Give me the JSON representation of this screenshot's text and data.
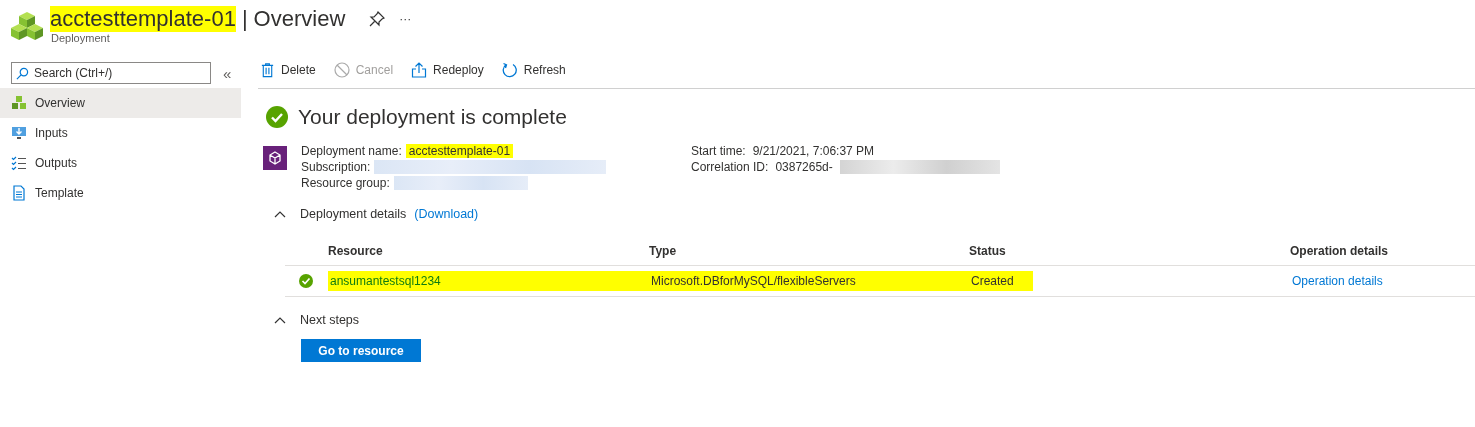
{
  "header": {
    "title": "acctesttemplate-01",
    "title_highlighted": true,
    "separator": "|",
    "page": "Overview",
    "subtitle": "Deployment",
    "more": "···"
  },
  "sidebar": {
    "search": {
      "placeholder": "Search (Ctrl+/)"
    },
    "collapse": "«",
    "items": [
      {
        "label": "Overview",
        "kind": "overview",
        "selected": true
      },
      {
        "label": "Inputs",
        "kind": "inputs",
        "selected": false
      },
      {
        "label": "Outputs",
        "kind": "outputs",
        "selected": false
      },
      {
        "label": "Template",
        "kind": "template",
        "selected": false
      }
    ]
  },
  "toolbar": [
    {
      "label": "Delete",
      "kind": "delete",
      "disabled": false
    },
    {
      "label": "Cancel",
      "kind": "cancel",
      "disabled": true
    },
    {
      "label": "Redeploy",
      "kind": "redeploy",
      "disabled": false
    },
    {
      "label": "Refresh",
      "kind": "refresh",
      "disabled": false
    }
  ],
  "status": {
    "title": "Your deployment is complete"
  },
  "info_left": [
    {
      "label": "Deployment name:",
      "value": "acctesttemplate-01",
      "highlighted": true
    },
    {
      "label": "Subscription:",
      "redacted": true
    },
    {
      "label": "Resource group:",
      "redacted": true
    }
  ],
  "info_right": [
    {
      "label": "Start time:",
      "value": "9/21/2021, 7:06:37 PM"
    },
    {
      "label": "Correlation ID:",
      "value": "0387265d-",
      "redacted": true
    }
  ],
  "details": {
    "title": "Deployment details",
    "link": "(Download)",
    "expanded": true,
    "columns": [
      "Resource",
      "Type",
      "Status",
      "Operation details"
    ],
    "rows": [
      {
        "resource": "ansumantestsql1234",
        "type": "Microsoft.DBforMySQL/flexibleServers",
        "status": "Created",
        "operation": "Operation details",
        "highlighted": true
      }
    ]
  },
  "next_steps": {
    "title": "Next steps",
    "expanded": true,
    "button": "Go to resource"
  }
}
